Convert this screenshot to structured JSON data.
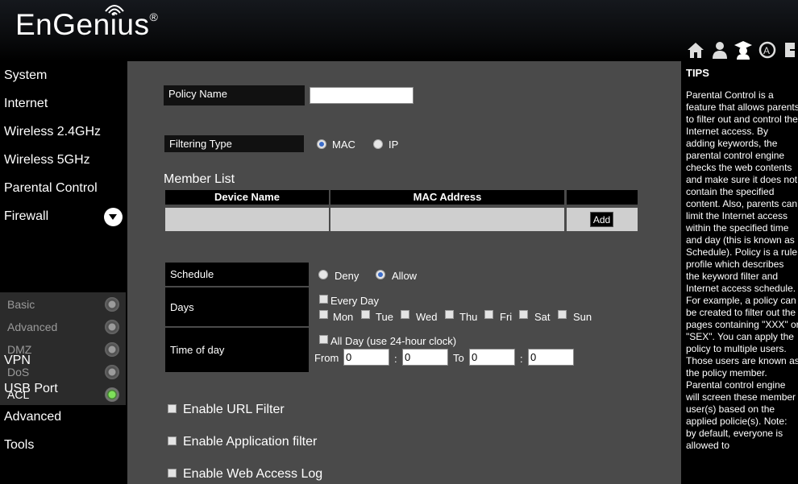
{
  "brand": {
    "name": "EnGenius",
    "mark": "®"
  },
  "nav": {
    "items": [
      "System",
      "Internet",
      "Wireless 2.4GHz",
      "Wireless 5GHz",
      "Parental Control",
      "Firewall"
    ],
    "sub_items": [
      "Basic",
      "Advanced",
      "DMZ",
      "DoS",
      "ACL"
    ],
    "active_sub": "ACL",
    "items_after": [
      "VPN",
      "USB Port",
      "Advanced",
      "Tools"
    ]
  },
  "icons": [
    "home-icon",
    "user-icon",
    "graduate-icon",
    "refresh-icon",
    "logout-icon"
  ],
  "form": {
    "policy_name_label": "Policy Name",
    "policy_name_value": "",
    "filtering_type_label": "Filtering Type",
    "filter_options": [
      "MAC",
      "IP"
    ],
    "filter_selected": "MAC",
    "member_list_title": "Member List",
    "columns": [
      "Device Name",
      "MAC Address",
      ""
    ],
    "add_label": "Add",
    "schedule_label": "Schedule",
    "schedule_options": [
      "Deny",
      "Allow"
    ],
    "schedule_selected": "Allow",
    "days_label": "Days",
    "every_day_label": "Every Day",
    "days": [
      "Mon",
      "Tue",
      "Wed",
      "Thu",
      "Fri",
      "Sat",
      "Sun"
    ],
    "time_label": "Time of day",
    "all_day_label": "All Day (use 24-hour clock)",
    "from_label": "From",
    "to_label": "To",
    "colon": ":",
    "from_hour": "0",
    "from_min": "0",
    "to_hour": "0",
    "to_min": "0",
    "enable_url": "Enable URL Filter",
    "enable_app": "Enable Application filter",
    "enable_log": "Enable Web Access Log"
  },
  "tips": {
    "title": "TIPS",
    "body": "Parental Control is a feature that allows parents to filter out and control the Internet access. By adding keywords, the parental control engine checks the web contents and make sure it does not contain the specified content. Also, parents can limit the Internet access within the specified time and day (this is known as Schedule). Policy is a rule profile which describes the keyword filter and Internet access schedule. For example, a policy can be created to filter out the pages containing \"XXX\" or \"SEX\". You can apply the policy to multiple users. Those users are known as the policy member. Parental control engine will screen these member user(s) based on the applied policie(s). Note: by default, everyone is allowed to"
  }
}
